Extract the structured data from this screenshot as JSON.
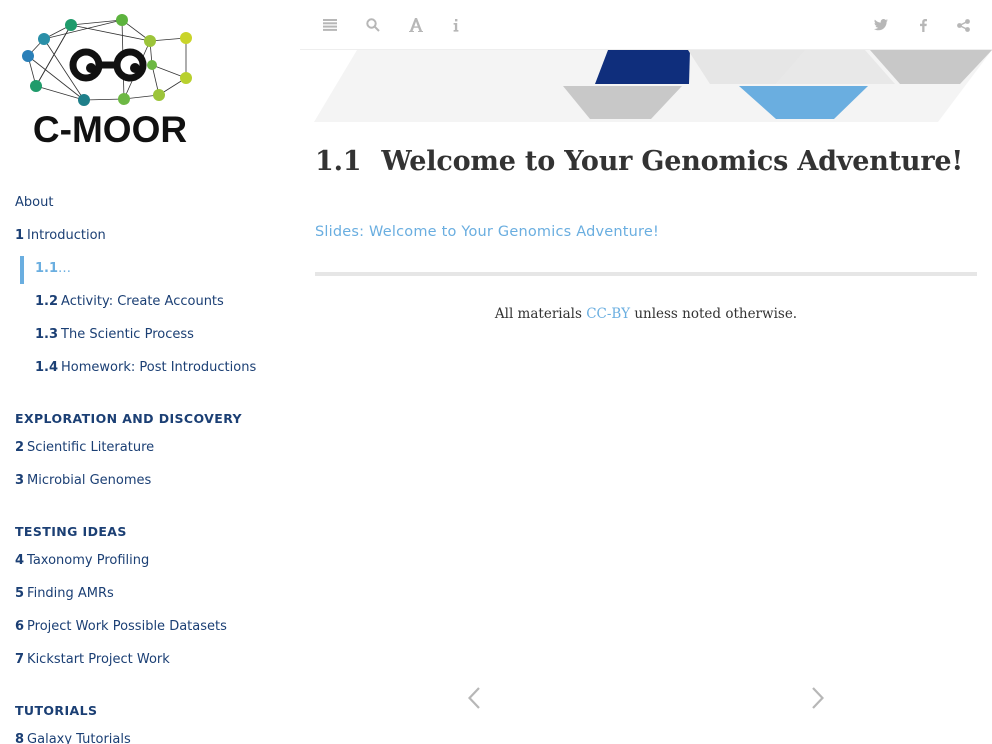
{
  "logo": {
    "wordmark": "C-MOOR"
  },
  "sidebar": {
    "items": [
      {
        "kind": "chap",
        "num": "",
        "label": "About"
      },
      {
        "kind": "chap",
        "num": "1",
        "label": "Introduction"
      },
      {
        "kind": "sub",
        "num": "1.1",
        "label": "Welcome to Your Genomics Adventure!",
        "active": true
      },
      {
        "kind": "sub",
        "num": "1.2",
        "label": "Activity: Create Accounts"
      },
      {
        "kind": "sub",
        "num": "1.3",
        "label": "The Scientic Process"
      },
      {
        "kind": "sub",
        "num": "1.4",
        "label": "Homework: Post Introductions"
      },
      {
        "kind": "part",
        "label": "EXPLORATION AND DISCOVERY"
      },
      {
        "kind": "chap",
        "num": "2",
        "label": "Scientific Literature"
      },
      {
        "kind": "chap",
        "num": "3",
        "label": "Microbial Genomes"
      },
      {
        "kind": "part",
        "label": "TESTING IDEAS"
      },
      {
        "kind": "chap",
        "num": "4",
        "label": "Taxonomy Profiling"
      },
      {
        "kind": "chap",
        "num": "5",
        "label": "Finding AMRs"
      },
      {
        "kind": "chap",
        "num": "6",
        "label": "Project Work Possible Datasets"
      },
      {
        "kind": "chap",
        "num": "7",
        "label": "Kickstart Project Work"
      },
      {
        "kind": "part",
        "label": "TUTORIALS"
      },
      {
        "kind": "chap",
        "num": "8",
        "label": "Galaxy Tutorials"
      }
    ]
  },
  "toolbar": {
    "left_icons": [
      "menu-icon",
      "search-icon",
      "font-size-icon",
      "info-icon"
    ],
    "right_icons": [
      "twitter-icon",
      "facebook-icon",
      "share-icon"
    ],
    "icon_color": "#b7b7b7"
  },
  "main": {
    "section_number": "1.1",
    "title": "Welcome to Your Genomics Adventure!",
    "slides_link": "Slides: Welcome to Your Genomics Adventure!",
    "license_prefix": "All materials",
    "license_link": "CC-BY",
    "license_suffix": "unless noted otherwise."
  },
  "navigation": {
    "prev_icon": "chevron-left-icon",
    "next_icon": "chevron-right-icon"
  },
  "colors": {
    "nav_text": "#1b3f74",
    "accent": "#6aaee0",
    "title_text": "#333333",
    "banner_navy": "#0f2e7c",
    "banner_blue": "#6aaee0",
    "banner_gray": "#c8c8c8"
  }
}
